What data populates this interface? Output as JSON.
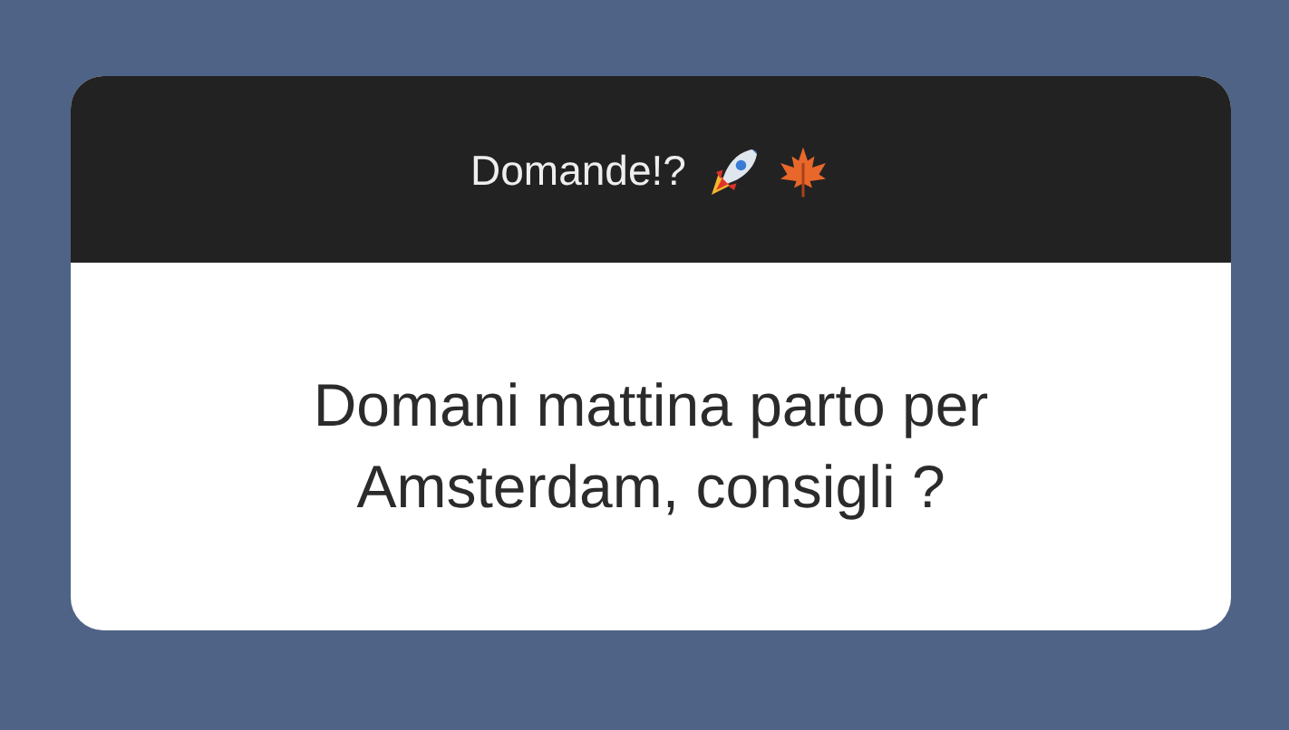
{
  "question_card": {
    "title": "Domande!?",
    "question": "Domani mattina parto per Amsterdam, consigli ?"
  }
}
